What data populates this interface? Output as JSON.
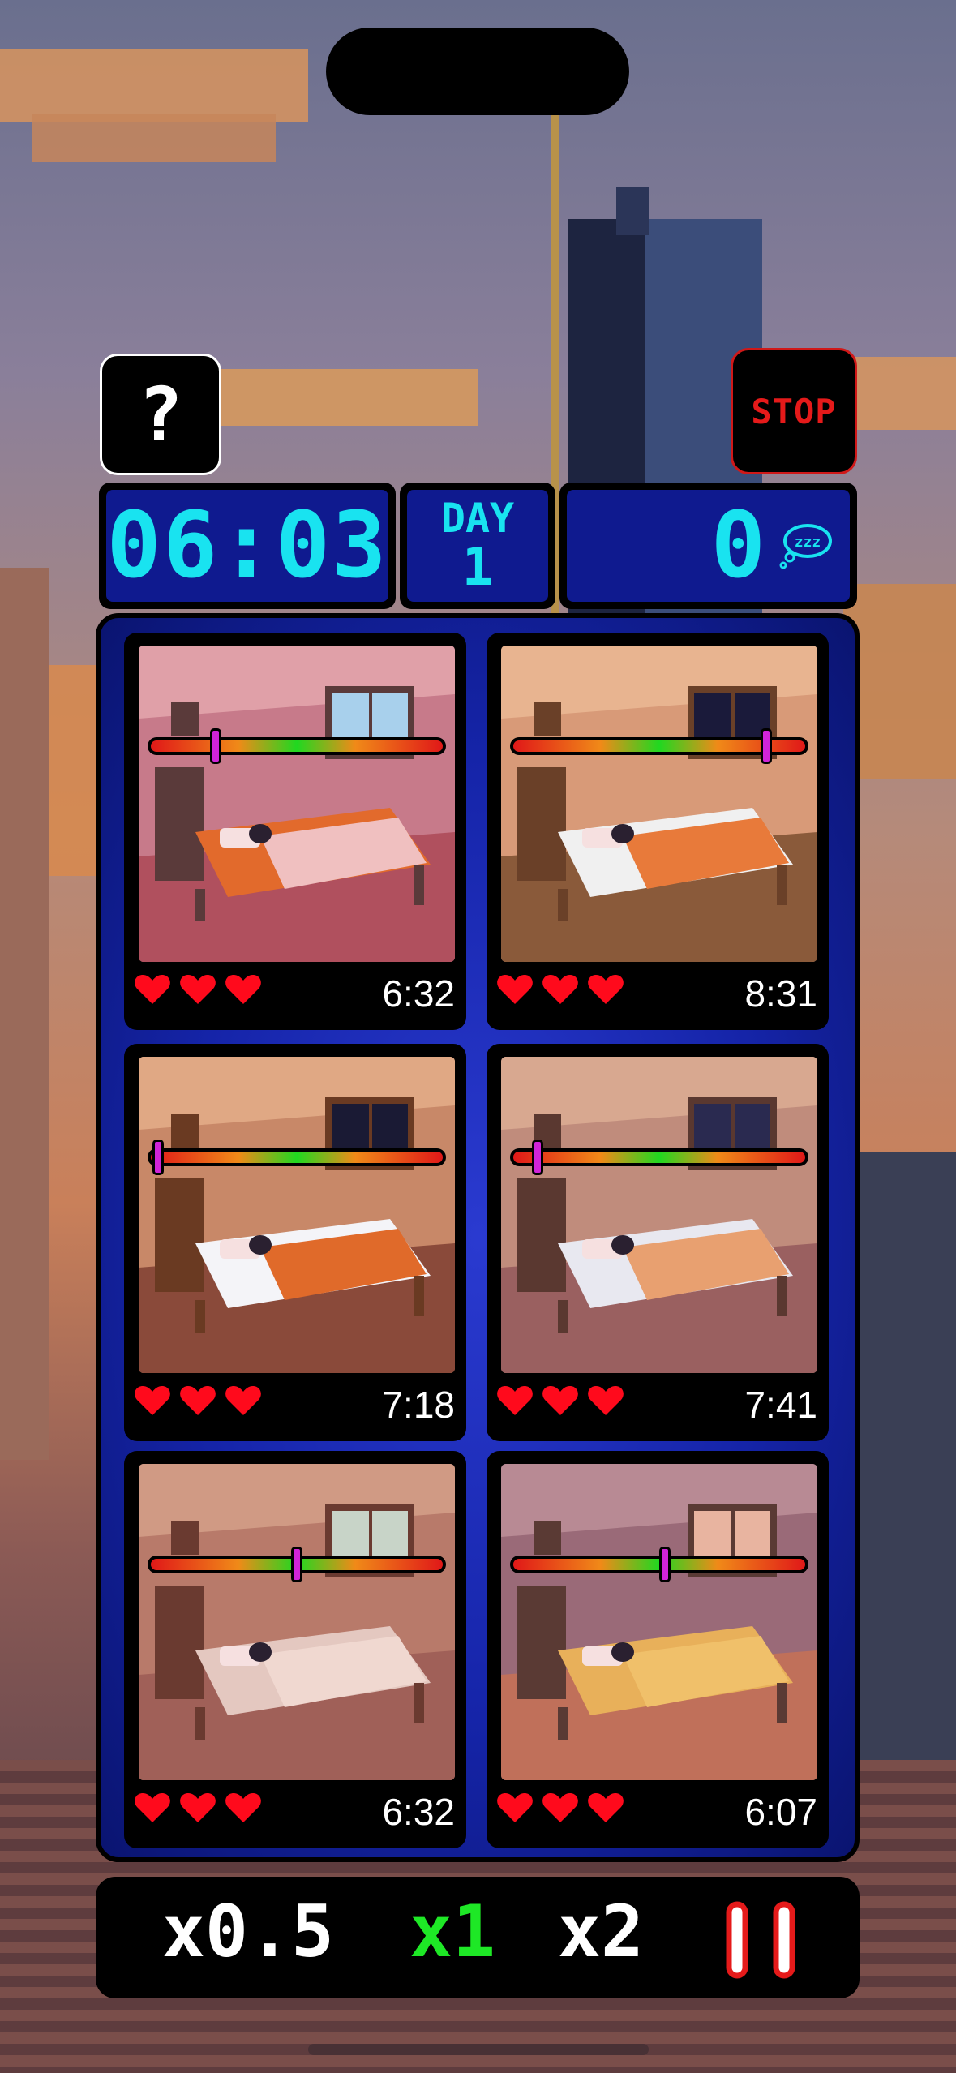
{
  "top": {
    "help_label": "?",
    "stop_label": "STOP"
  },
  "hud": {
    "clock": "06:03",
    "day_label": "DAY",
    "day_number": "1",
    "score": "0",
    "score_icon": "sleep-zzz-icon"
  },
  "rooms": [
    {
      "scene": "pink-bedroom",
      "hearts": 3,
      "sleep_level": 0.22,
      "time": "6:32"
    },
    {
      "scene": "night-bedroom",
      "hearts": 3,
      "sleep_level": 0.87,
      "time": "8:31"
    },
    {
      "scene": "lamp-bedroom",
      "hearts": 3,
      "sleep_level": 0.02,
      "time": "7:18"
    },
    {
      "scene": "moon-window-bedroom",
      "hearts": 3,
      "sleep_level": 0.08,
      "time": "7:41"
    },
    {
      "scene": "curtain-bedroom",
      "hearts": 3,
      "sleep_level": 0.5,
      "time": "6:32"
    },
    {
      "scene": "purple-bedroom",
      "hearts": 3,
      "sleep_level": 0.52,
      "time": "6:07"
    }
  ],
  "speed": {
    "options": [
      "x0.5",
      "x1",
      "x2"
    ],
    "selected": "x1",
    "pause_icon": "pause-icon"
  },
  "colors": {
    "accent_cyan": "#19e3f0",
    "panel_blue": "#0f1a8f",
    "heart_red": "#ff0a1c",
    "active_green": "#1ee826",
    "stop_red": "#e51a1a"
  }
}
